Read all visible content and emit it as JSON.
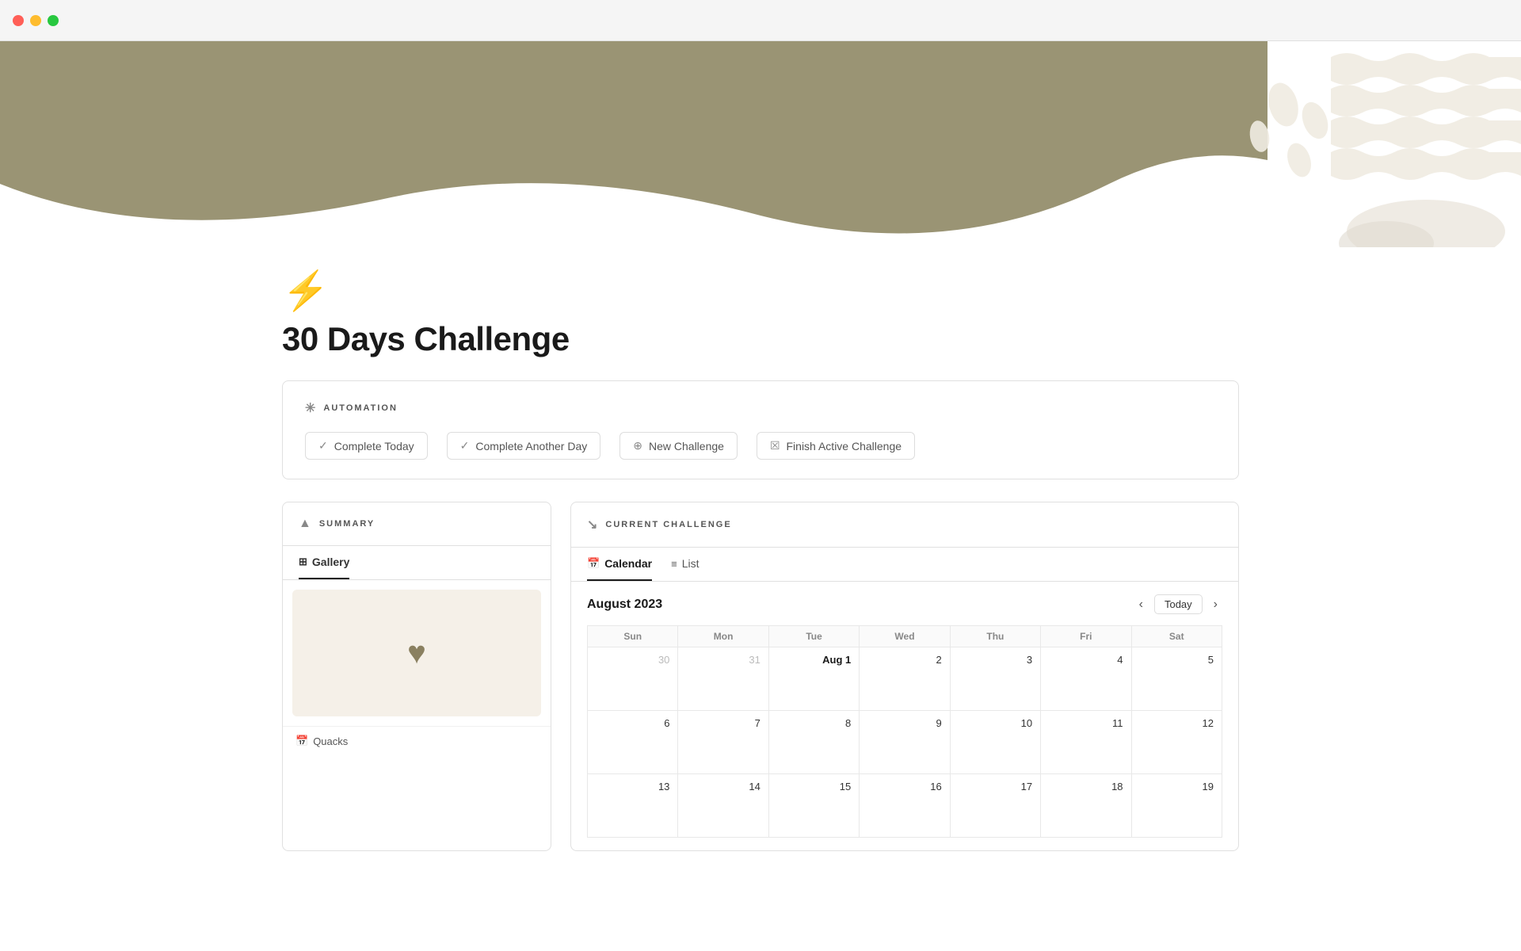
{
  "titlebar": {
    "dot_red": "close",
    "dot_yellow": "minimize",
    "dot_green": "maximize"
  },
  "page": {
    "icon": "⚡",
    "title": "30 Days Challenge"
  },
  "automation": {
    "section_label": "AUTOMATION",
    "buttons": [
      {
        "id": "complete-today",
        "label": "Complete Today",
        "icon": "✓"
      },
      {
        "id": "complete-another-day",
        "label": "Complete Another Day",
        "icon": "✓"
      },
      {
        "id": "new-challenge",
        "label": "New Challenge",
        "icon": "+"
      },
      {
        "id": "finish-active-challenge",
        "label": "Finish Active Challenge",
        "icon": "☒"
      }
    ]
  },
  "summary": {
    "section_label": "SUMMARY",
    "tabs": [
      {
        "id": "gallery",
        "label": "Gallery",
        "icon": "⊞",
        "active": true
      }
    ],
    "card": {
      "footer_icon": "📅",
      "footer_text": "Quacks"
    }
  },
  "current_challenge": {
    "section_label": "CURRENT CHALLENGE",
    "tabs": [
      {
        "id": "calendar",
        "label": "Calendar",
        "icon": "📅",
        "active": true
      },
      {
        "id": "list",
        "label": "List",
        "icon": "≡",
        "active": false
      }
    ],
    "calendar": {
      "month_label": "August 2023",
      "today_button": "Today",
      "days_of_week": [
        "Sun",
        "Mon",
        "Tue",
        "Wed",
        "Thu",
        "Fri",
        "Sat"
      ],
      "weeks": [
        [
          {
            "day": "30",
            "other": true
          },
          {
            "day": "31",
            "other": true
          },
          {
            "day": "Aug 1",
            "today": true
          },
          {
            "day": "2"
          },
          {
            "day": "3"
          },
          {
            "day": "4"
          },
          {
            "day": "5"
          }
        ]
      ]
    }
  }
}
